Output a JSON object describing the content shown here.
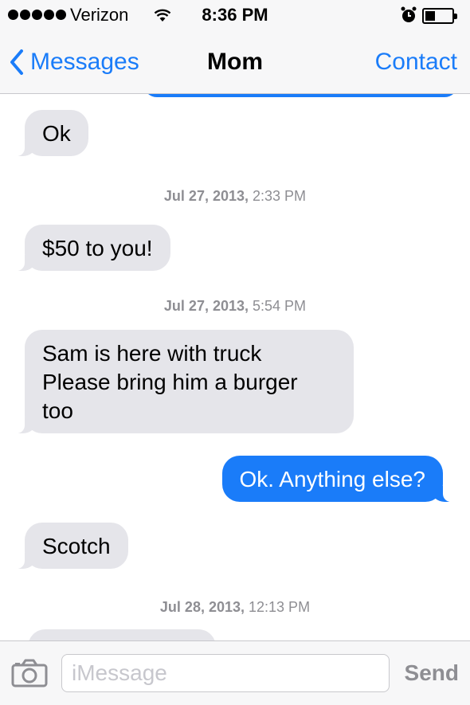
{
  "status_bar": {
    "carrier": "Verizon",
    "time": "8:36 PM"
  },
  "nav": {
    "back_label": "Messages",
    "title": "Mom",
    "contact_label": "Contact"
  },
  "messages": [
    {
      "type": "incoming",
      "lines": [
        "Ok"
      ]
    },
    {
      "type": "timestamp",
      "date": "Jul 27, 2013,",
      "time": "2:33 PM"
    },
    {
      "type": "incoming",
      "lines": [
        "$50 to you!"
      ]
    },
    {
      "type": "timestamp",
      "date": "Jul 27, 2013,",
      "time": "5:54 PM"
    },
    {
      "type": "incoming",
      "lines": [
        "Sam is here with truck",
        "Please bring him a burger",
        "too"
      ]
    },
    {
      "type": "outgoing",
      "lines": [
        "Ok. Anything else?"
      ]
    },
    {
      "type": "incoming",
      "lines": [
        "Scotch"
      ]
    },
    {
      "type": "timestamp",
      "date": "Jul 28, 2013,",
      "time": "12:13 PM"
    }
  ],
  "input": {
    "placeholder": "iMessage",
    "value": "",
    "send_label": "Send"
  },
  "colors": {
    "accent": "#1a7cf9",
    "incoming_bubble": "#e5e5ea",
    "outgoing_bubble": "#1a7cf9",
    "timestamp_text": "#8e8e93"
  },
  "icons": {
    "back": "chevron-left-icon",
    "camera": "camera-icon",
    "wifi": "wifi-icon",
    "alarm": "alarm-clock-icon",
    "battery": "battery-icon",
    "signal": "signal-dots-icon"
  }
}
